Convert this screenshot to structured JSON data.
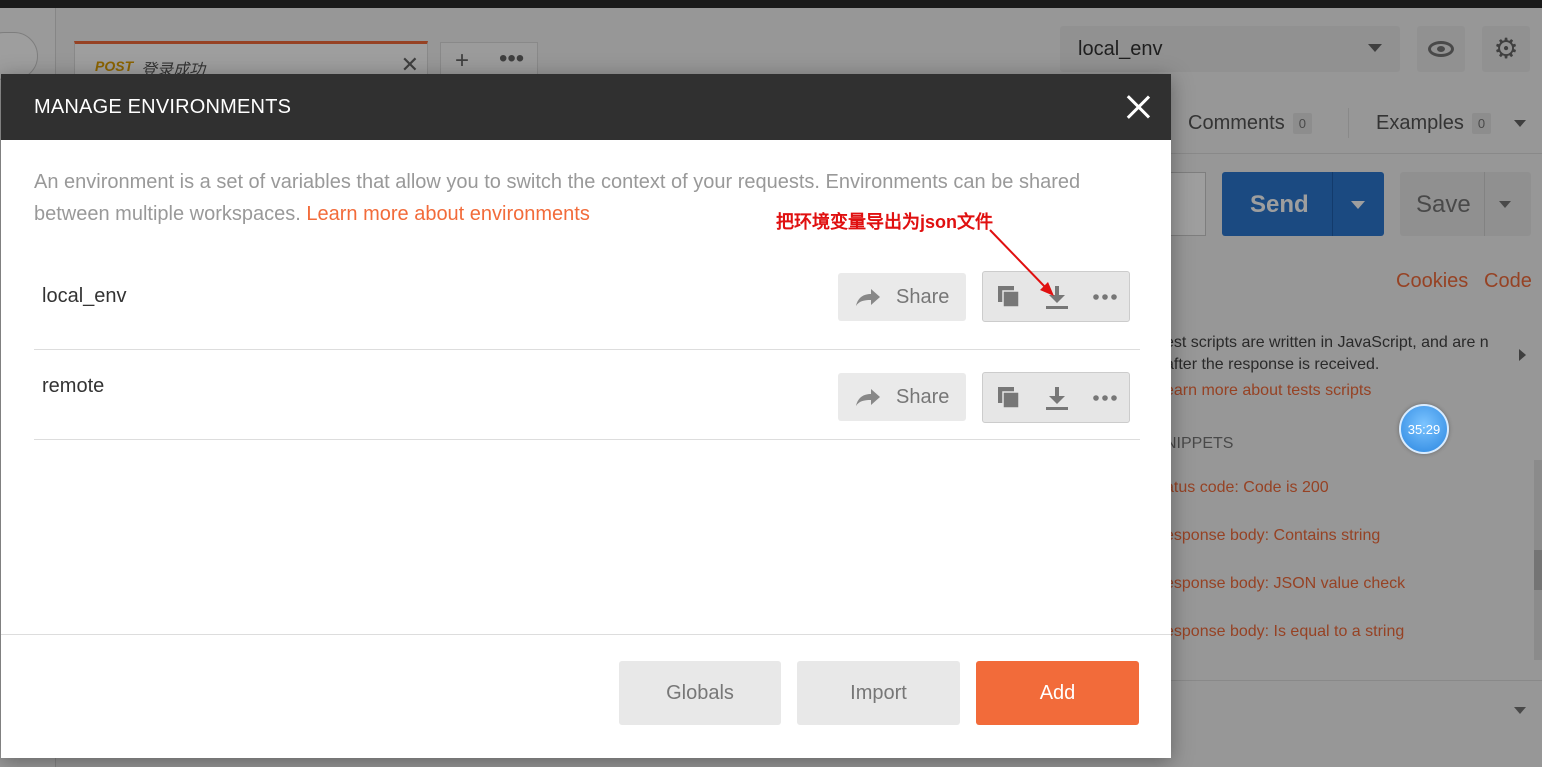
{
  "background": {
    "request_tab": {
      "method": "POST",
      "name": "登录成功"
    },
    "environment_selector": {
      "value": "local_env"
    },
    "subtabs": {
      "comments_label": "Comments",
      "comments_count": "0",
      "examples_label": "Examples",
      "examples_count": "0"
    },
    "send_label": "Send",
    "save_label": "Save",
    "cookies_label": "Cookies",
    "code_label": "Code",
    "tests_text": "est scripts are written in JavaScript, and are n after the response is received.",
    "tests_learn_more": "earn more about tests scripts",
    "snippets_heading": "NIPPETS",
    "snippets": [
      "atus code: Code is 200",
      "esponse body: Contains string",
      "esponse body: JSON value check",
      "esponse body: Is equal to a string"
    ]
  },
  "timer": "35:29",
  "modal": {
    "title": "MANAGE ENVIRONMENTS",
    "description": "An environment is a set of variables that allow you to switch the context of your requests. Environments can be shared between multiple workspaces.",
    "learn_more": "Learn more about environments",
    "share_label": "Share",
    "environments": [
      {
        "name": "local_env"
      },
      {
        "name": "remote"
      }
    ],
    "footer": {
      "globals": "Globals",
      "import": "Import",
      "add": "Add"
    }
  },
  "annotation": {
    "text": "把环境变量导出为json文件",
    "color": "#e01010"
  },
  "colors": {
    "accent": "#f26b3a",
    "send_blue": "#2d78d0",
    "header_dark": "#303030"
  }
}
